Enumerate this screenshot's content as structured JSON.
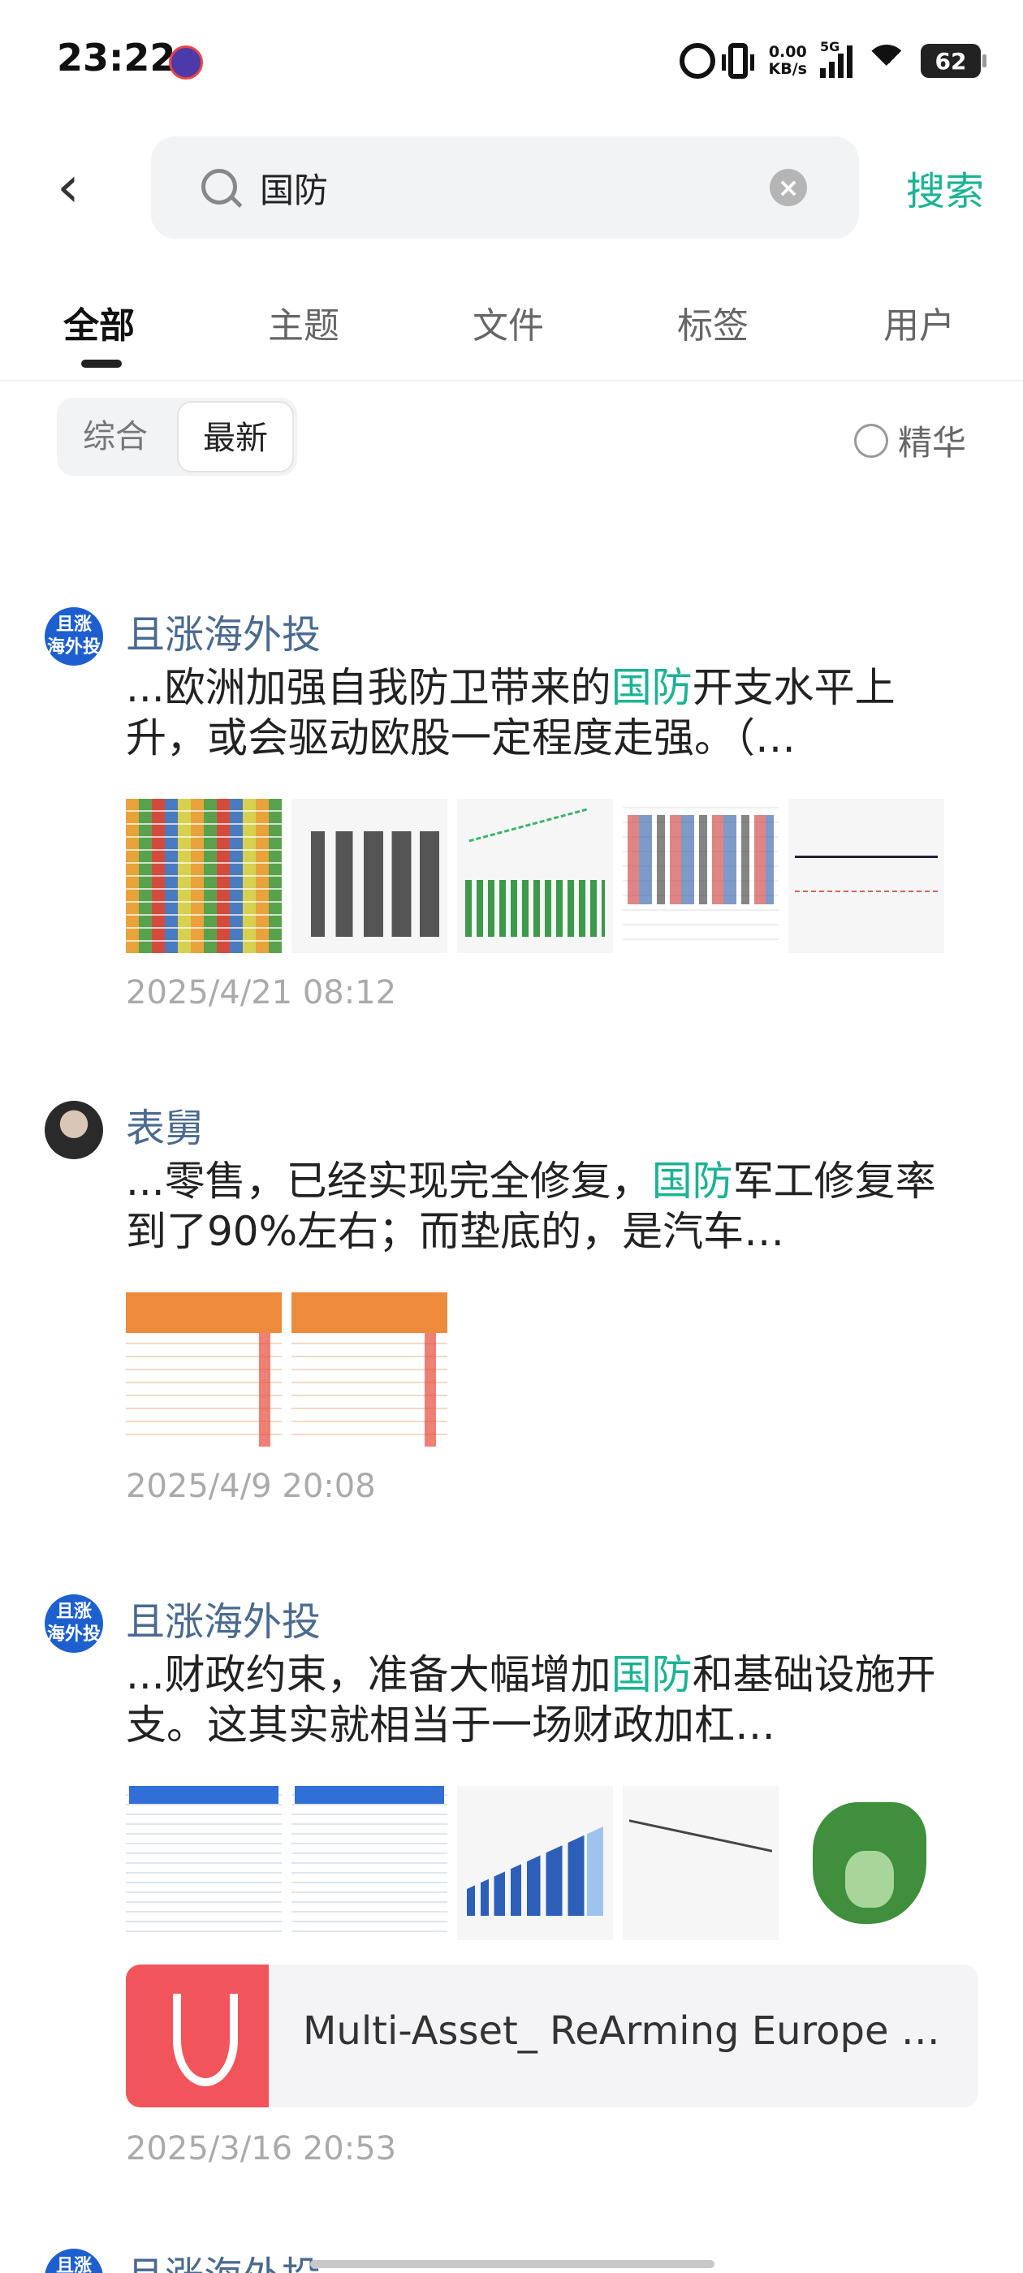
{
  "status_bar": {
    "time": "23:22",
    "net_speed_value": "0.00",
    "net_speed_unit": "KB/s",
    "signal_label": "5G",
    "battery": "62"
  },
  "search": {
    "query": "国防",
    "submit_label": "搜索"
  },
  "tabs": [
    {
      "label": "全部"
    },
    {
      "label": "主题"
    },
    {
      "label": "文件"
    },
    {
      "label": "标签"
    },
    {
      "label": "用户"
    }
  ],
  "filter": {
    "options": [
      "综合",
      "最新"
    ],
    "selected": "最新",
    "toggle_label": "精华"
  },
  "posts": [
    {
      "author": "且涨海外投",
      "avatar_text": "且涨\n海外投",
      "snippet_pre": "...欧洲加强自我防卫带来的",
      "snippet_hl": "国防",
      "snippet_post": "开支水平上升，或会驱动欧股一定程度走强。（…",
      "date": "2025/4/21 08:12"
    },
    {
      "author": "表舅",
      "snippet_pre": "...零售，已经实现完全修复，",
      "snippet_hl": "国防",
      "snippet_post": "军工修复率到了90%左右；而垫底的，是汽车…",
      "date": "2025/4/9 20:08"
    },
    {
      "author": "且涨海外投",
      "avatar_text": "且涨\n海外投",
      "snippet_pre": "...财政约束，准备大幅增加",
      "snippet_hl": "国防",
      "snippet_post": "和基础设施开支。这其实就相当于一场财政加杠…",
      "file_name": "Multi-Asset_ ReArming Europe …",
      "date": "2025/3/16 20:53"
    },
    {
      "author": "且涨海外投"
    }
  ],
  "colors": {
    "accent": "#1bb394",
    "author": "#4a6a8f",
    "file_icon": "#f2545b"
  }
}
